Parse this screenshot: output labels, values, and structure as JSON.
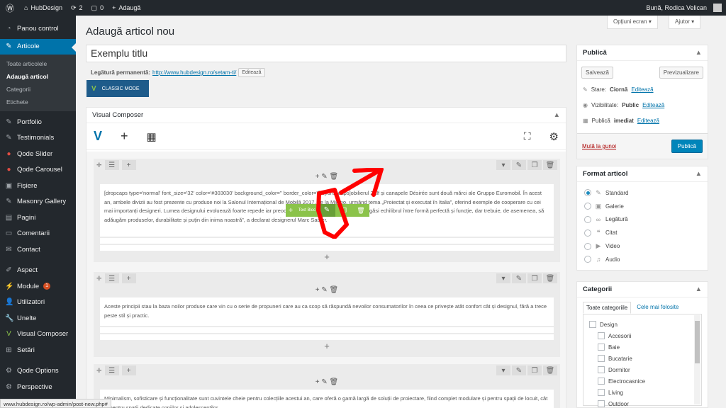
{
  "adminbar": {
    "site_name": "HubDesign",
    "updates_count": "2",
    "comments_count": "0",
    "new_label": "Adaugă",
    "greeting": "Bună, Rodica Velican"
  },
  "sidebar": {
    "items": [
      {
        "label": "Panou control",
        "icon": "dashboard-icon"
      },
      {
        "label": "Articole",
        "icon": "pin-icon"
      },
      {
        "label": "Portfolio",
        "icon": "pin-icon"
      },
      {
        "label": "Testimonials",
        "icon": "pin-icon"
      },
      {
        "label": "Qode Slider",
        "icon": "circle-icon"
      },
      {
        "label": "Qode Carousel",
        "icon": "circle-icon"
      },
      {
        "label": "Fișiere",
        "icon": "media-icon"
      },
      {
        "label": "Masonry Gallery",
        "icon": "pin-icon"
      },
      {
        "label": "Pagini",
        "icon": "page-icon"
      },
      {
        "label": "Comentarii",
        "icon": "comment-icon"
      },
      {
        "label": "Contact",
        "icon": "mail-icon"
      },
      {
        "label": "Aspect",
        "icon": "brush-icon"
      },
      {
        "label": "Module",
        "icon": "plugin-icon",
        "badge": "1"
      },
      {
        "label": "Utilizatori",
        "icon": "user-icon"
      },
      {
        "label": "Unelte",
        "icon": "wrench-icon"
      },
      {
        "label": "Visual Composer",
        "icon": "vc-icon"
      },
      {
        "label": "Setări",
        "icon": "settings-icon"
      },
      {
        "label": "Qode Options",
        "icon": "gear-icon"
      },
      {
        "label": "Perspective",
        "icon": "gear-icon"
      }
    ],
    "submenu": [
      "Toate articolele",
      "Adaugă articol",
      "Categorii",
      "Etichete"
    ]
  },
  "screen_options": "Opțiuni ecran",
  "help": "Ajutor",
  "page_title": "Adaugă articol nou",
  "post_title": "Exemplu titlu",
  "permalink": {
    "label": "Legătură permanentă:",
    "url": "http://www.hubdesign.ro/setam-ti/",
    "edit": "Editează"
  },
  "classic_mode": "CLASSIC MODE",
  "vc": {
    "title": "Visual Composer",
    "element_toolbar_label": "Text Bloc",
    "rows": [
      {
        "text": "[dropcaps type='normal' font_size='32' color='#303030' background_color='' border_color='']M[/dropcaps]obilierul Zalf și canapele Désirée sunt două mărci ale Gruppo Euromobil. În acest an, ambele divizii au fost prezente cu produse noi la Salonul Internațional de Mobilă 2017, de la Milano, urmând tema „Proiectat și executat în Italia”, oferind exemple de cooperare cu cei mai importanți designeri. Lumea designului evoluează foarte repede iar preocuparea „nu mai este doar despre a găsi echilibrul între formă perfectă și funcție, dar trebuie, de asemenea, să adăugăm produselor, durabilitate și puțin din inima noastră”, a declarat designerul Marc Sadler."
      },
      {
        "text": "Aceste principii stau la baza noilor produse care vin cu o serie de propuneri care au ca scop să răspundă nevoilor consumatorilor în ceea ce privește atât confort cât și designul, fără a trece peste stil și practic."
      },
      {
        "text": "Minimalism, sofisticare și funcționalitate sunt cuvintele cheie pentru colecțiile acestui an, care oferă o gamă largă de soluții de proiectare, fiind complet modulare și pentru spații de locuit, cât și pentru spații dedicate copiilor și adolescenților."
      }
    ]
  },
  "publish": {
    "title": "Publică",
    "save_draft": "Salvează",
    "preview": "Previzualizare",
    "status_label": "Stare:",
    "status_value": "Ciornă",
    "visibility_label": "Vizibilitate:",
    "visibility_value": "Public",
    "publish_label": "Publică",
    "publish_value": "imediat",
    "edit": "Editează",
    "trash": "Mută la gunoi",
    "publish_button": "Publică"
  },
  "format": {
    "title": "Format articol",
    "options": [
      "Standard",
      "Galerie",
      "Legătură",
      "Citat",
      "Video",
      "Audio"
    ],
    "selected": "Standard"
  },
  "categories": {
    "title": "Categorii",
    "tab_all": "Toate categoriile",
    "tab_popular": "Cele mai folosite",
    "parent": "Design",
    "children": [
      "Accesorii",
      "Baie",
      "Bucatarie",
      "Dormitor",
      "Electrocasnice",
      "Living",
      "Outdoor"
    ]
  },
  "status_url": "www.hubdesign.ro/wp-admin/post-new.php#",
  "colors": {
    "accent": "#0073aa",
    "adminbar": "#23282d",
    "vc_green": "#8bc34a",
    "annotation_red": "#ff0000"
  }
}
